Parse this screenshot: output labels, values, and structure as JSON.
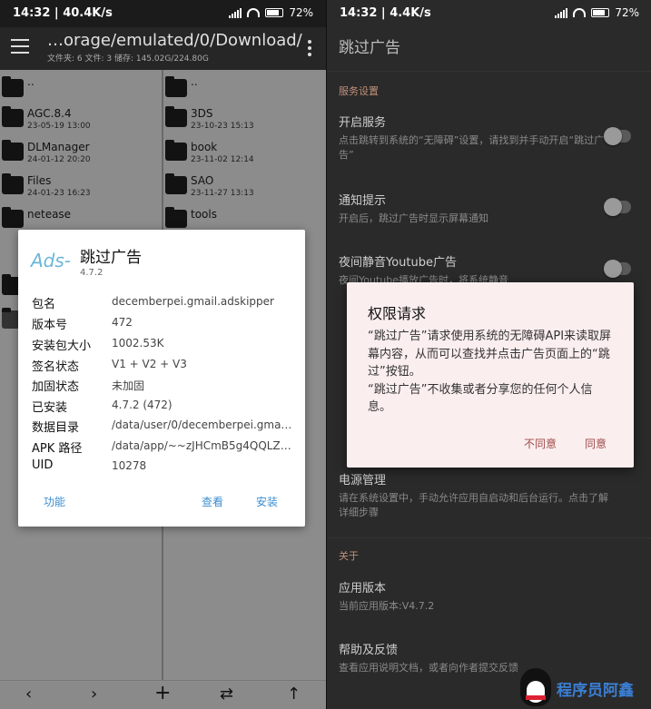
{
  "left": {
    "status": {
      "time": "14:32",
      "speed": "40.4K/s",
      "battery": "72%"
    },
    "path": "…orage/emulated/0/Download/",
    "path_info": "文件夹: 6  文件: 3  储存: 145.02G/224.80G",
    "col_a": [
      {
        "name": "..",
        "date": ""
      },
      {
        "name": "AGC.8.4",
        "date": "23-05-19 13:00"
      },
      {
        "name": "DLManager",
        "date": "24-01-12 20:20"
      },
      {
        "name": "Files",
        "date": "24-01-23 16:23"
      },
      {
        "name": "netease",
        "date": ""
      }
    ],
    "col_b": [
      {
        "name": "..",
        "date": ""
      },
      {
        "name": "3DS",
        "date": "23-10-23 15:13"
      },
      {
        "name": "book",
        "date": "23-11-02 12:14"
      },
      {
        "name": "SAO",
        "date": "23-11-27 13:13"
      },
      {
        "name": "tools",
        "date": ""
      }
    ],
    "dialog": {
      "logo": "Ads-",
      "title": "跳过广告",
      "version": "4.7.2",
      "info": [
        {
          "k": "包名",
          "v": "decemberpei.gmail.adskipper"
        },
        {
          "k": "版本号",
          "v": "472"
        },
        {
          "k": "安装包大小",
          "v": "1002.53K"
        },
        {
          "k": "签名状态",
          "v": "V1 + V2 + V3"
        },
        {
          "k": "加固状态",
          "v": "未加固"
        },
        {
          "k": "已安装",
          "v": "4.7.2 (472)"
        },
        {
          "k": "数据目录",
          "v": "/data/user/0/decemberpei.gmai..."
        },
        {
          "k": "APK 路径",
          "v": "/data/app/~~zJHCmB5g4QQLZj..."
        },
        {
          "k": "UID",
          "v": "10278"
        }
      ],
      "btn_func": "功能",
      "btn_view": "查看",
      "btn_install": "安装"
    },
    "bottom": {
      "back": "‹",
      "forward": "›",
      "add": "+",
      "swap": "⇄",
      "up": "↑"
    }
  },
  "right": {
    "status": {
      "time": "14:32",
      "speed": "4.4K/s",
      "battery": "72%"
    },
    "title": "跳过广告",
    "section_service": "服务设置",
    "s1": {
      "t": "开启服务",
      "d": "点击跳转到系统的“无障碍”设置，请找到并手动开启“跳过广告”"
    },
    "s2": {
      "t": "通知提示",
      "d": "开启后，跳过广告时显示屏幕通知"
    },
    "s3": {
      "t": "夜间静音Youtube广告",
      "d": "夜间Youtube播放广告时，将系统静音"
    },
    "s4": {
      "t": "电源管理",
      "d": "请在系统设置中，手动允许应用自启动和后台运行。点击了解详细步骤"
    },
    "section_about": "关于",
    "s5": {
      "t": "应用版本",
      "d": "当前应用版本:V4.7.2"
    },
    "s6": {
      "t": "帮助及反馈",
      "d": "查看应用说明文档，或者向作者提交反馈"
    },
    "perm": {
      "title": "权限请求",
      "body": "“跳过广告”请求使用系统的无障碍API来读取屏幕内容，从而可以查找并点击广告页面上的“跳过”按钮。\n“跳过广告”不收集或者分享您的任何个人信息。",
      "disagree": "不同意",
      "agree": "同意"
    },
    "watermark": "程序员阿鑫"
  }
}
